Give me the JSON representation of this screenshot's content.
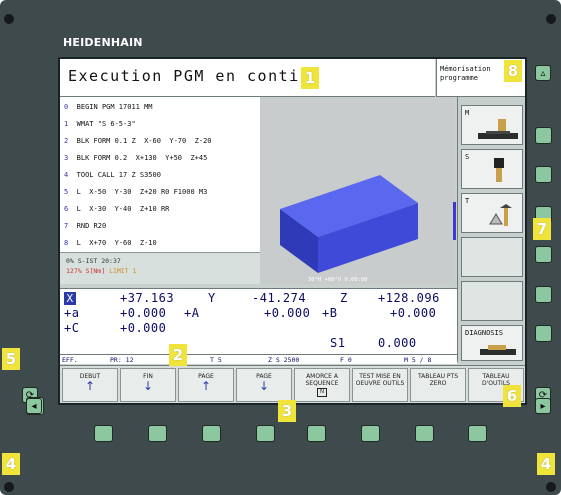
{
  "brand": "HEIDENHAIN",
  "header": {
    "title": "Execution PGM en continu",
    "mode_line1": "Mémorisation",
    "mode_line2": "programme"
  },
  "program": {
    "lines": [
      {
        "num": "0",
        "text": "BEGIN PGM 17011 MM"
      },
      {
        "num": "1",
        "text": "WMAT \"S 6-5-3\""
      },
      {
        "num": "2",
        "text": "BLK FORM 0.1 Z  X-60  Y-70  Z-20"
      },
      {
        "num": "3",
        "text": "BLK FORM 0.2  X+130  Y+50  Z+45"
      },
      {
        "num": "4",
        "text": "TOOL CALL 17 Z S3500"
      },
      {
        "num": "5",
        "text": "L  X-50  Y-30  Z+20 R0 F1000 M3"
      },
      {
        "num": "6",
        "text": "L  X-30  Y-40  Z+10 RR"
      },
      {
        "num": "7",
        "text": "RND R20"
      },
      {
        "num": "8",
        "text": "L  X+70  Y-60  Z-10"
      }
    ]
  },
  "status": {
    "progress_text": "0% S-IST 20:37",
    "override_text": "127% S[Nm]",
    "limit_text": "LIMIT 1"
  },
  "view": {
    "footer": "30°H +60°V          0:00:00"
  },
  "tools": {
    "slot1_label": "M",
    "slot2_label": "S",
    "slot3_label": "T",
    "diagnosis_label": "DIAGNOSIS"
  },
  "coords": {
    "x_label": "X",
    "x_value": "+37.163",
    "y_label": "Y",
    "y_value": "-41.274",
    "z_label": "Z",
    "z_value": "+128.096",
    "a_label": "+a",
    "a_value": "+0.000",
    "ba_label": "+A",
    "ba_value": "+0.000",
    "bb_label": "+B",
    "bb_value": "+0.000",
    "c_label": "+C",
    "c_value": "+0.000",
    "s1_label": "S1",
    "s1_value": "0.000"
  },
  "eff_row": {
    "eff": "EFF.",
    "pr": "PR: 12",
    "t": "T 5",
    "z": "Z S 2500",
    "f": "F 0",
    "m": "M 5 / 8"
  },
  "softkeys": [
    {
      "label": "DEBUT",
      "arrow": "↑"
    },
    {
      "label": "FIN",
      "arrow": "↓"
    },
    {
      "label": "PAGE",
      "arrow": "↑"
    },
    {
      "label": "PAGE",
      "arrow": "↓"
    },
    {
      "label": "AMORCE A SEQUENCE",
      "boxed": "N"
    },
    {
      "label": "TEST MISE EN OEUVRE OUTILS"
    },
    {
      "label": "TABLEAU PTS ZERO"
    },
    {
      "label": "TABLEAU D'OUTILS"
    }
  ],
  "callouts": [
    "1",
    "2",
    "3",
    "4",
    "4",
    "5",
    "6",
    "7",
    "8"
  ],
  "colors": {
    "bezel": "#3f4a4d",
    "key_green": "#8cc7a0",
    "callout_yellow": "#f0e43a",
    "screen_bg": "#c9d1cf",
    "block_blue": "#4a58e0"
  }
}
